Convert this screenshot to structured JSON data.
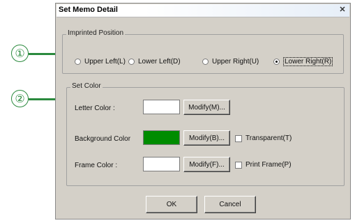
{
  "dialog": {
    "title": "Set  Memo Detail",
    "close_glyph": "✕"
  },
  "callouts": [
    {
      "label": "①"
    },
    {
      "label": "②"
    }
  ],
  "imprinted_position": {
    "legend": "Imprinted Position",
    "options": [
      {
        "label": "Upper Left(L)",
        "selected": false
      },
      {
        "label": "Lower Left(D)",
        "selected": false
      },
      {
        "label": "Upper Right(U)",
        "selected": false
      },
      {
        "label": "Lower Right(R)",
        "selected": true
      }
    ]
  },
  "set_color": {
    "legend": "Set Color",
    "letter": {
      "label": "Letter Color :",
      "swatch": "#ffffff",
      "button": "Modify(M)..."
    },
    "background": {
      "label": "Background Color",
      "swatch": "#008c00",
      "button": "Modify(B)...",
      "checkbox": "Transparent(T)"
    },
    "frame": {
      "label": "Frame Color :",
      "swatch": "#ffffff",
      "button": "Modify(F)...",
      "checkbox": "Print Frame(P)"
    }
  },
  "footer": {
    "ok": "OK",
    "cancel": "Cancel"
  },
  "colors": {
    "accent": "#2b8a3e",
    "dialog_bg": "#d4d0c8"
  }
}
